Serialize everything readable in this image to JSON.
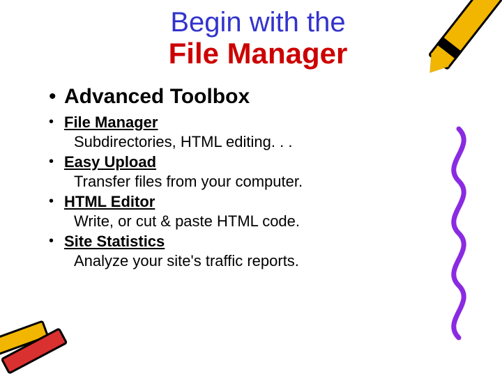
{
  "title": {
    "line1": "Begin with the",
    "line2": "File Manager"
  },
  "section_heading": "Advanced Toolbox",
  "items": [
    {
      "link": "File Manager",
      "desc": "Subdirectories, HTML editing. . ."
    },
    {
      "link": "Easy Upload",
      "desc": "Transfer files from your computer."
    },
    {
      "link": "HTML Editor",
      "desc": "Write, or cut & paste HTML code."
    },
    {
      "link": "Site Statistics",
      "desc": "Analyze your site's traffic reports."
    }
  ],
  "colors": {
    "title_line1": "#3333cc",
    "title_line2": "#cc0000",
    "squiggle": "#8a2be2"
  }
}
